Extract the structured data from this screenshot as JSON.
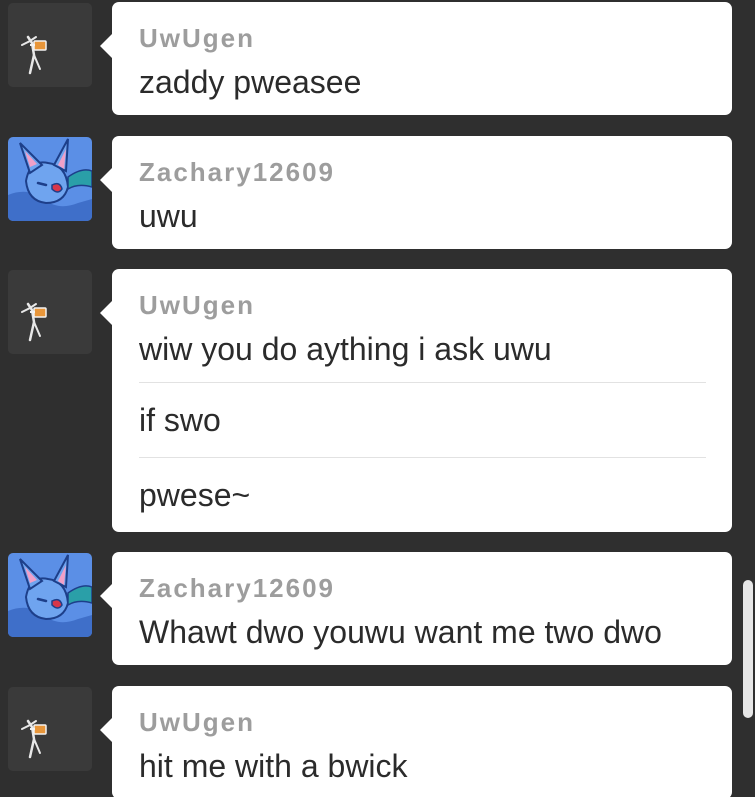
{
  "messages": [
    {
      "username": "UwUgen",
      "avatar_icon": "tool-sketch-icon",
      "lines": [
        "zaddy pweasee"
      ]
    },
    {
      "username": "Zachary12609",
      "avatar_icon": "blue-bat-creature-icon",
      "lines": [
        "uwu"
      ]
    },
    {
      "username": "UwUgen",
      "avatar_icon": "tool-sketch-icon",
      "lines": [
        "wiw you do aything i ask uwu",
        "if swo",
        "pwese~"
      ]
    },
    {
      "username": "Zachary12609",
      "avatar_icon": "blue-bat-creature-icon",
      "lines": [
        "Whawt dwo youwu want me two dwo"
      ]
    },
    {
      "username": "UwUgen",
      "avatar_icon": "tool-sketch-icon",
      "lines": [
        "hit me with a bwick"
      ]
    }
  ],
  "colors": {
    "background": "#2f2f2f",
    "bubble": "#ffffff",
    "username": "#9d9d9d",
    "text": "#2b2b2b",
    "scrollbar_thumb": "#e6e6e6"
  }
}
